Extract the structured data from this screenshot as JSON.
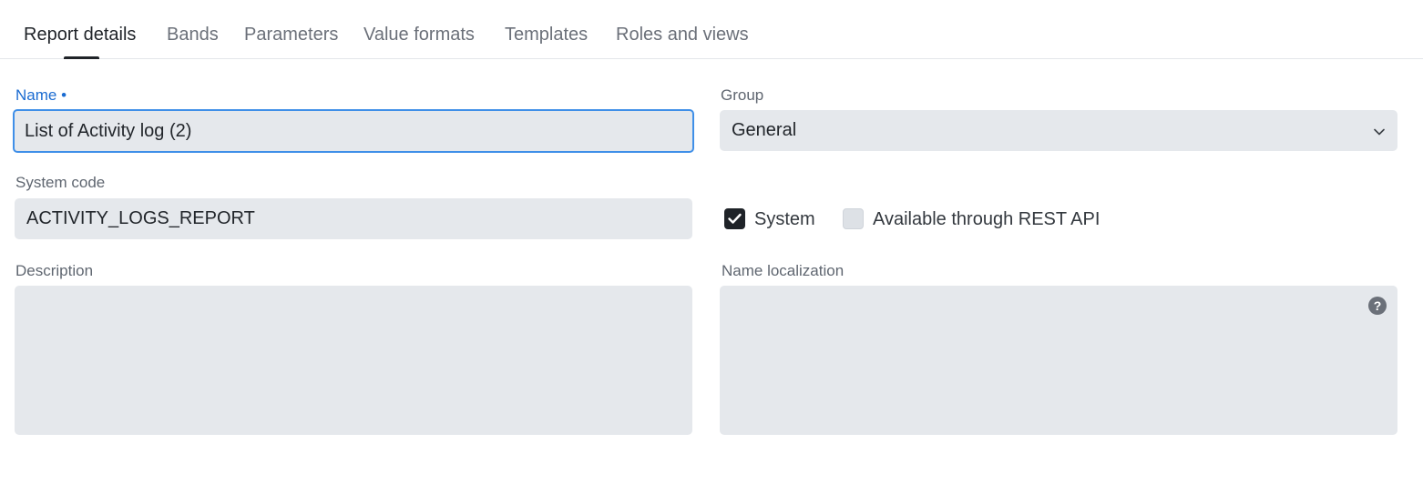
{
  "tabs": [
    {
      "label": "Report details",
      "active": true
    },
    {
      "label": "Bands"
    },
    {
      "label": "Parameters"
    },
    {
      "label": "Value formats"
    },
    {
      "label": "Templates"
    },
    {
      "label": "Roles and views"
    }
  ],
  "form": {
    "name": {
      "label": "Name •",
      "value": "List of Activity log (2)"
    },
    "group": {
      "label": "Group",
      "value": "General"
    },
    "system_code": {
      "label": "System code",
      "value": "ACTIVITY_LOGS_REPORT"
    },
    "system_checkbox": {
      "label": "System",
      "checked": true
    },
    "rest_api_checkbox": {
      "label": "Available through REST API",
      "checked": false
    },
    "description": {
      "label": "Description",
      "value": ""
    },
    "name_localization": {
      "label": "Name localization",
      "value": ""
    }
  },
  "icons": {
    "help": "?"
  },
  "colors": {
    "accent": "#1a6bd1",
    "focus_border": "#3f8fe8",
    "field_bg": "#e5e8ec",
    "checked_bg": "#1f2328"
  }
}
